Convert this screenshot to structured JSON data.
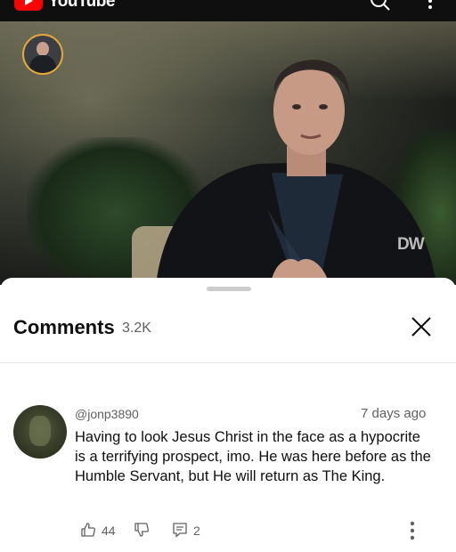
{
  "app": {
    "name": "YouTube"
  },
  "video": {
    "watermark": "DW"
  },
  "comments_panel": {
    "title": "Comments",
    "count": "3.2K"
  },
  "comments": [
    {
      "author": "@jonp3890",
      "time": "7 days ago",
      "text": "Having to look Jesus Christ in the face as a hypocrite is a terrifying prospect, imo. He was here before as the Humble Servant, but He will return as The King.",
      "likes": "44",
      "replies": "2"
    }
  ],
  "icons": {
    "logo": "youtube-logo-icon",
    "search": "search-icon",
    "more": "more-vert-icon",
    "close": "close-icon",
    "like": "thumbs-up-icon",
    "dislike": "thumbs-down-icon",
    "reply": "reply-icon"
  },
  "colors": {
    "brand": "#ff0000",
    "avatar_ring": "#e6a93a",
    "text_secondary": "#606060"
  }
}
